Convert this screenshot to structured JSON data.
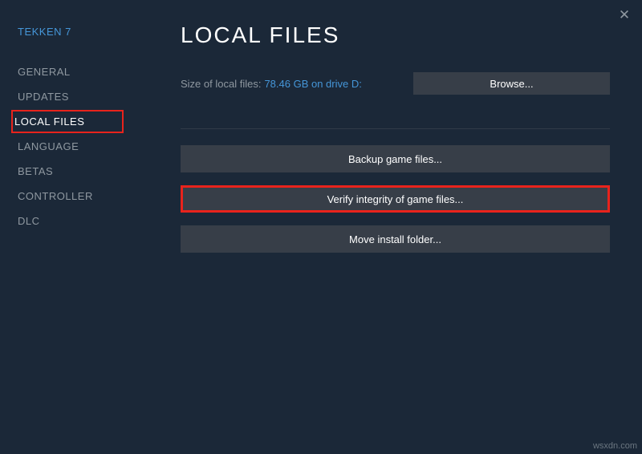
{
  "gameTitle": "TEKKEN 7",
  "sidebar": {
    "items": [
      {
        "label": "GENERAL"
      },
      {
        "label": "UPDATES"
      },
      {
        "label": "LOCAL FILES"
      },
      {
        "label": "LANGUAGE"
      },
      {
        "label": "BETAS"
      },
      {
        "label": "CONTROLLER"
      },
      {
        "label": "DLC"
      }
    ]
  },
  "main": {
    "title": "LOCAL FILES",
    "sizeLabel": "Size of local files:",
    "sizeValue": "78.46 GB on drive D:",
    "browseLabel": "Browse...",
    "backupLabel": "Backup game files...",
    "verifyLabel": "Verify integrity of game files...",
    "moveLabel": "Move install folder..."
  },
  "watermark": "wsxdn.com"
}
